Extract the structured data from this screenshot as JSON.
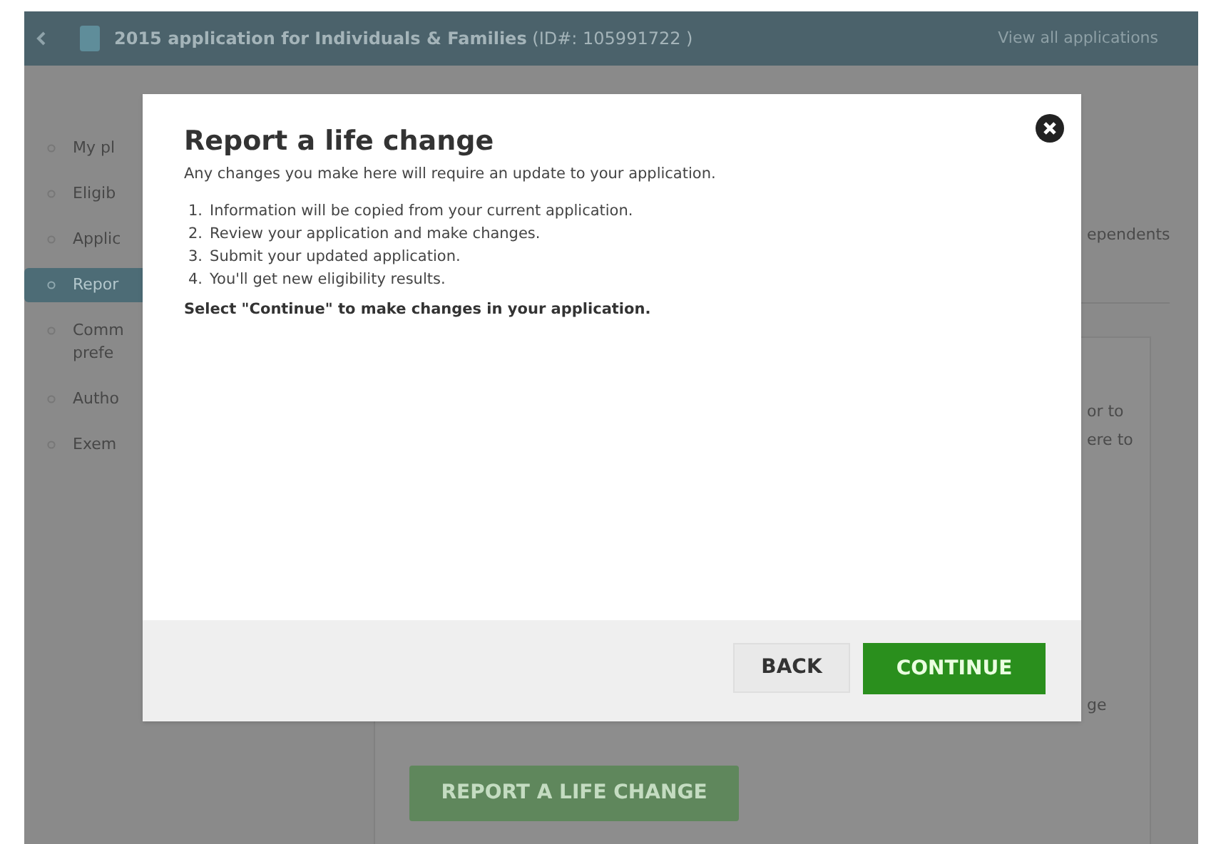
{
  "header": {
    "title": "2015 application for Individuals & Families",
    "id": "(ID#: 105991722 )",
    "link": "View all applications"
  },
  "sidebar": {
    "items": [
      {
        "lines": [
          "My pl"
        ],
        "selected": false
      },
      {
        "lines": [
          "Eligib"
        ],
        "selected": false
      },
      {
        "lines": [
          "Applic"
        ],
        "selected": false
      },
      {
        "lines": [
          "Repor"
        ],
        "selected": true
      },
      {
        "lines": [
          "Comm",
          "prefe"
        ],
        "selected": false
      },
      {
        "lines": [
          "Autho"
        ],
        "selected": false
      },
      {
        "lines": [
          "Exem"
        ],
        "selected": false
      }
    ]
  },
  "content": {
    "tab_fragment": "ependents",
    "text_fragments": [
      "or to",
      "ere to"
    ],
    "lower_fragment": "ge",
    "report_button": "REPORT A LIFE CHANGE"
  },
  "modal": {
    "title": "Report a life change",
    "intro": "Any changes you make here will require an update to your application.",
    "steps": [
      {
        "number": "1.",
        "text": "Information will be copied from your current application."
      },
      {
        "number": "2.",
        "text": "Review your application and make changes."
      },
      {
        "number": "3.",
        "text": "Submit your updated application."
      },
      {
        "number": "4.",
        "text": "You'll get new eligibility results."
      }
    ],
    "instruction": "Select \"Continue\" to make changes in your application.",
    "back_button": "BACK",
    "continue_button": "CONTINUE"
  }
}
